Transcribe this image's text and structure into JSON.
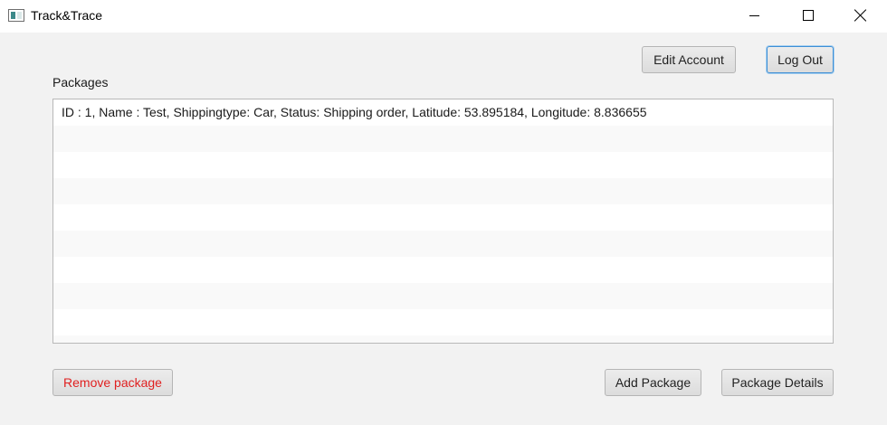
{
  "window": {
    "title": "Track&Trace",
    "controls": [
      "minimize-icon",
      "maximize-icon",
      "close-icon"
    ]
  },
  "header": {
    "edit_account_label": "Edit Account",
    "log_out_label": "Log Out"
  },
  "packages": {
    "label": "Packages",
    "items": [
      "ID : 1, Name : Test, Shippingtype: Car, Status: Shipping order, Latitude: 53.895184, Longitude: 8.836655"
    ]
  },
  "footer": {
    "remove_label": "Remove package",
    "add_label": "Add Package",
    "details_label": "Package Details"
  },
  "colors": {
    "background": "#f2f2f2",
    "remove_text": "#e02020",
    "focus_border": "#3d8fd6"
  }
}
